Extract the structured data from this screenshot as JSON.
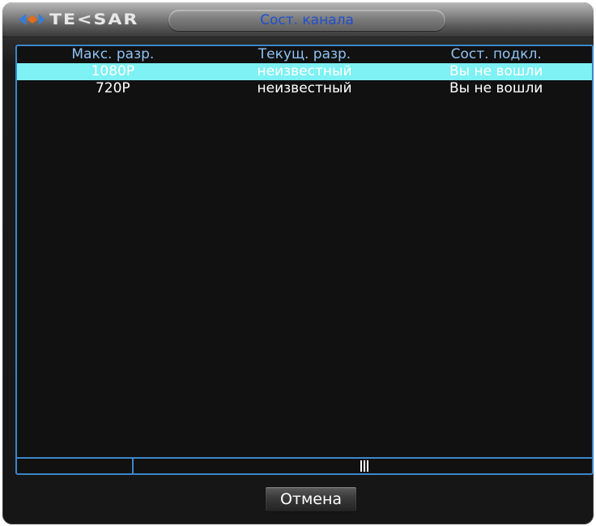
{
  "window": {
    "logo_text": "TE<SAR",
    "title": "Сост. канала"
  },
  "table": {
    "headers": [
      "Макс. разр.",
      "Текущ. разр.",
      "Сост. подкл."
    ],
    "rows": [
      {
        "max_res": "1080P",
        "current_res": "неизвестный",
        "status": "Вы не вошли",
        "selected": true
      },
      {
        "max_res": "720P",
        "current_res": "неизвестный",
        "status": "Вы не вошли",
        "selected": false
      }
    ],
    "scroll_marker": "|||"
  },
  "buttons": {
    "cancel_label": "Отмена"
  },
  "colors": {
    "title_text": "#1f4fd0",
    "header_text": "#8fc2f3",
    "grid_border": "#3d86c9",
    "selected_row": "#7ef1f4",
    "logo_arrow": "#3a7bd5",
    "logo_arrow_accent": "#e86a1a"
  },
  "icons": {
    "logo_mark": "diamond-arrows-icon"
  }
}
